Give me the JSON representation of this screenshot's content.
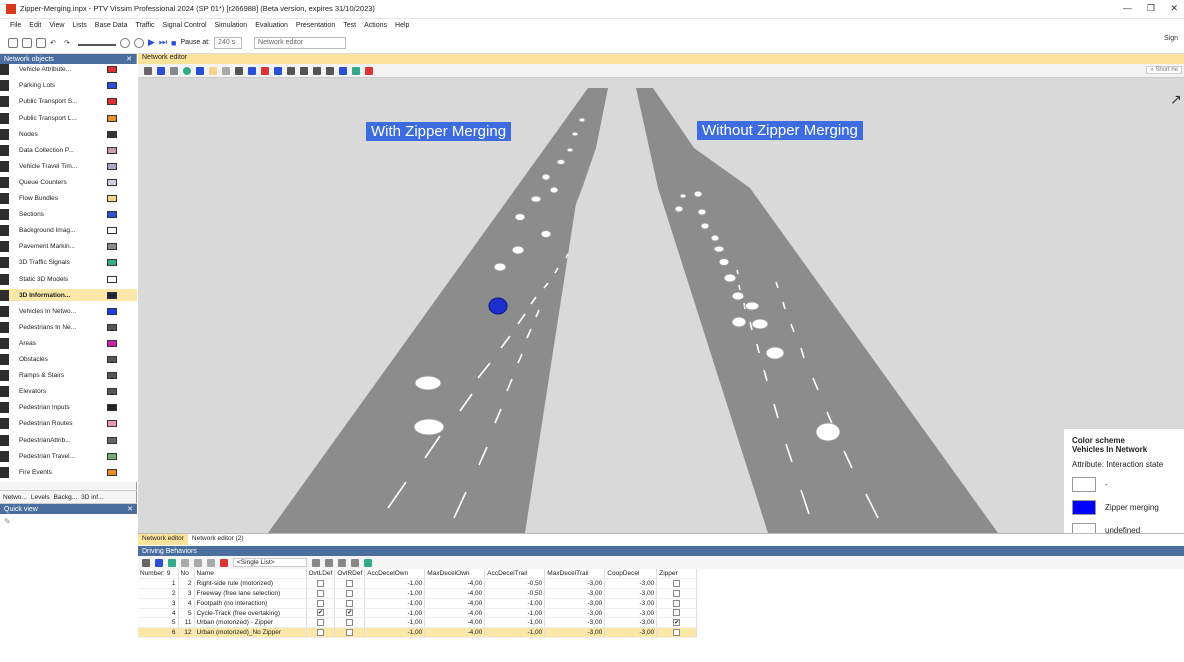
{
  "window": {
    "title": "Zipper-Merging.inpx - PTV Vissim Professional 2024 (SP 01*) [r266988] (Beta version, expires 31/10/2023)",
    "sign_in": "Sign"
  },
  "menu": [
    "File",
    "Edit",
    "View",
    "Lists",
    "Base Data",
    "Traffic",
    "Signal Control",
    "Simulation",
    "Evaluation",
    "Presentation",
    "Test",
    "Actions",
    "Help"
  ],
  "toolbar": {
    "pause_label": "Pause at:",
    "pause_value": "240 s",
    "editor_select": "Network editor"
  },
  "left_panel": {
    "title": "Network objects",
    "items": [
      {
        "label": "Vehicle Attribute...",
        "color": "#d33"
      },
      {
        "label": "Parking Lots",
        "color": "#2a4fd6"
      },
      {
        "label": "Public Transport S...",
        "color": "#d33"
      },
      {
        "label": "Public Transport L...",
        "color": "#e98c2b"
      },
      {
        "label": "Nodes",
        "color": "#333"
      },
      {
        "label": "Data Collection P...",
        "color": "#c9a"
      },
      {
        "label": "Vehicle Travel Tim...",
        "color": "#aac"
      },
      {
        "label": "Queue Counters",
        "color": "#ccd"
      },
      {
        "label": "Flow Bundles",
        "color": "#f4d48a"
      },
      {
        "label": "Sections",
        "color": "#2a4fd6"
      },
      {
        "label": "Background Imag...",
        "color": "#fff"
      },
      {
        "label": "Pavement Markin...",
        "color": "#888"
      },
      {
        "label": "3D Traffic Signals",
        "color": "#3a8"
      },
      {
        "label": "Static 3D Models",
        "color": "#fff"
      },
      {
        "label": "3D Information...",
        "color": "#224"
      },
      {
        "label": "Vehicles In Netwo...",
        "color": "#1a3ff0"
      },
      {
        "label": "Pedestrians In Ne...",
        "color": "#555"
      },
      {
        "label": "Areas",
        "color": "#c2a"
      },
      {
        "label": "Obstacles",
        "color": "#555"
      },
      {
        "label": "Ramps & Stairs",
        "color": "#555"
      },
      {
        "label": "Elevators",
        "color": "#555"
      },
      {
        "label": "Pedestrian Inputs",
        "color": "#222"
      },
      {
        "label": "Pedestrian Routes",
        "color": "#e9a"
      },
      {
        "label": "PedestrianAttrib...",
        "color": "#666"
      },
      {
        "label": "Pedestrian Travel...",
        "color": "#7a7"
      },
      {
        "label": "Fire Events",
        "color": "#e98c2b"
      }
    ],
    "tabs": [
      "Netwo...",
      "Levels",
      "Backg...",
      "3D inf..."
    ],
    "quick_view": "Quick view"
  },
  "editor": {
    "tab": "Network editor",
    "short_help": "» Short he",
    "banner_left": "With Zipper Merging",
    "banner_right": "Without Zipper Merging"
  },
  "legend": {
    "title1": "Color scheme",
    "title2": "Vehicles In Network",
    "attribute": "Attribute: Interaction state",
    "entries": [
      {
        "label": "-",
        "color": "#ffffff"
      },
      {
        "label": "Zipper merging",
        "color": "#0000ff"
      },
      {
        "label": "undefined",
        "color": "#ffffff"
      }
    ]
  },
  "editor_tabs": [
    "Network editor",
    "Network editor (2)"
  ],
  "bottom": {
    "title": "Driving Behaviors",
    "list_select": "<Single List>",
    "columns": [
      "Number: 9",
      "No",
      "Name",
      "OvtLDef",
      "OvtRDef",
      "AccDecelOwn",
      "MaxDecelOwn",
      "AccDecelTrail",
      "MaxDecelTrail",
      "CoopDecel",
      "Zipper"
    ],
    "rows": [
      {
        "idx": "1",
        "no": "2",
        "name": "Right-side rule (motorized)",
        "l": false,
        "r": false,
        "a": "-1,00",
        "m": "-4,00",
        "at": "-0,50",
        "mt": "-3,00",
        "c": "-3,00",
        "z": false
      },
      {
        "idx": "2",
        "no": "3",
        "name": "Freeway (free lane selection)",
        "l": false,
        "r": false,
        "a": "-1,00",
        "m": "-4,00",
        "at": "-0,50",
        "mt": "-3,00",
        "c": "-3,00",
        "z": false
      },
      {
        "idx": "3",
        "no": "4",
        "name": "Footpath (no interaction)",
        "l": false,
        "r": false,
        "a": "-1,00",
        "m": "-4,00",
        "at": "-1,00",
        "mt": "-3,00",
        "c": "-3,00",
        "z": false
      },
      {
        "idx": "4",
        "no": "5",
        "name": "Cycle-Track (free overtaking)",
        "l": true,
        "r": true,
        "a": "-1,00",
        "m": "-4,00",
        "at": "-1,00",
        "mt": "-3,00",
        "c": "-3,00",
        "z": false
      },
      {
        "idx": "5",
        "no": "11",
        "name": "Urban (motorized) - Zipper",
        "l": false,
        "r": false,
        "a": "-1,00",
        "m": "-4,00",
        "at": "-1,00",
        "mt": "-3,00",
        "c": "-3,00",
        "z": true
      },
      {
        "idx": "6",
        "no": "12",
        "name": "Urban (motorized)_No Zipper",
        "l": false,
        "r": false,
        "a": "-1,00",
        "m": "-4,00",
        "at": "-1,00",
        "mt": "-3,00",
        "c": "-3,00",
        "z": false
      }
    ]
  }
}
